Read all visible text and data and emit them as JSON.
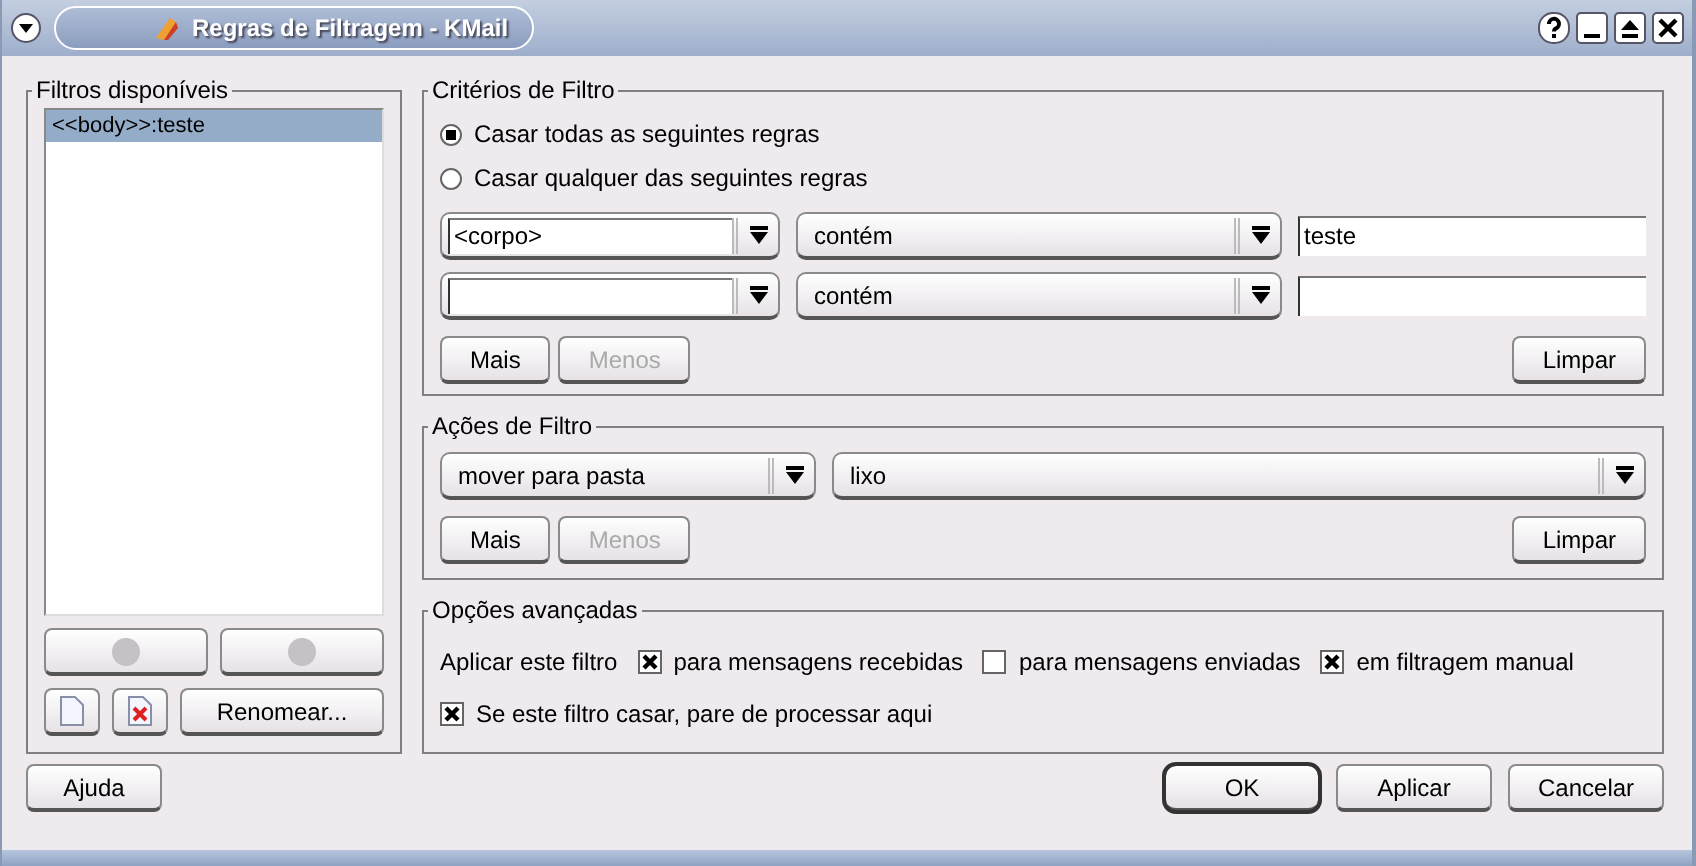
{
  "window": {
    "title": "Regras de Filtragem - KMail"
  },
  "filters_panel": {
    "title": "Filtros disponíveis",
    "items": [
      {
        "label": "<<body>>:teste",
        "selected": true
      }
    ],
    "rename_button": "Renomear..."
  },
  "criteria": {
    "title": "Critérios de Filtro",
    "match_options": [
      {
        "label": "Casar todas as seguintes regras",
        "selected": true
      },
      {
        "label": "Casar qualquer das seguintes regras",
        "selected": false
      }
    ],
    "rules": [
      {
        "field": "<corpo>",
        "operator": "contém",
        "value": "teste"
      },
      {
        "operator": "contém"
      }
    ],
    "buttons": [
      {
        "label": "Mais",
        "disabled": false
      },
      {
        "label": "Menos",
        "disabled": true
      }
    ],
    "clear_button": "Limpar"
  },
  "actions": {
    "title": "Ações de Filtro",
    "rows": [
      {
        "action": "mover para pasta",
        "argument": "lixo"
      }
    ],
    "buttons": [
      {
        "label": "Mais",
        "disabled": false
      },
      {
        "label": "Menos",
        "disabled": true
      }
    ],
    "clear_button": "Limpar"
  },
  "advanced": {
    "title": "Opções avançadas",
    "apply_label": "Aplicar este filtro",
    "apply_options": [
      {
        "label": "para mensagens recebidas",
        "checked": true
      },
      {
        "label": "para mensagens enviadas",
        "checked": false
      },
      {
        "label": "em filtragem manual",
        "checked": true
      }
    ],
    "stop_option": {
      "label": "Se este filtro casar, pare de processar aqui",
      "checked": true
    }
  },
  "footer": {
    "help_button": "Ajuda",
    "buttons": [
      {
        "label": "OK",
        "focused": true
      },
      {
        "label": "Aplicar",
        "focused": false
      },
      {
        "label": "Cancelar",
        "focused": false
      }
    ]
  }
}
